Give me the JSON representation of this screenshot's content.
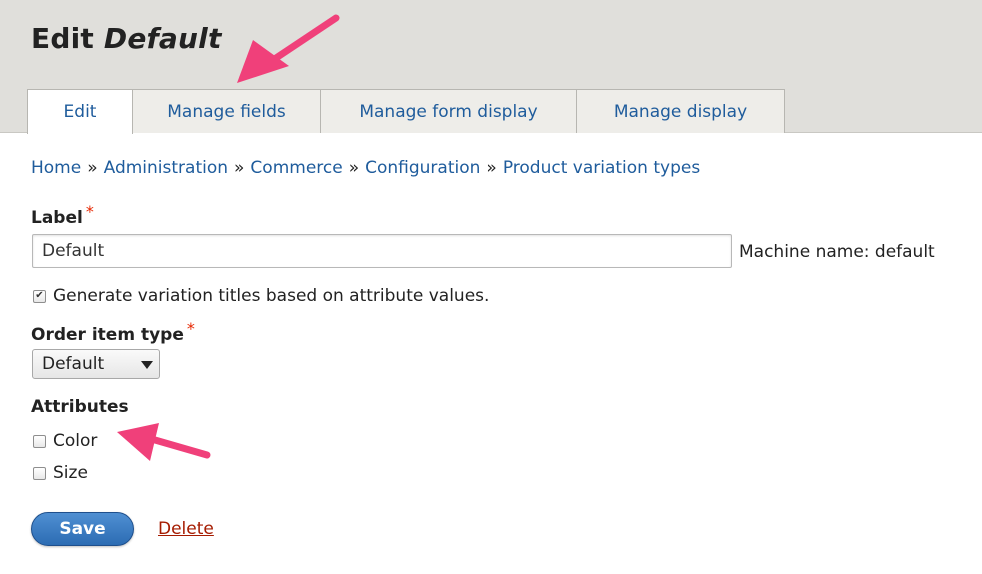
{
  "page": {
    "title_prefix": "Edit",
    "title_name": "Default"
  },
  "tabs": [
    {
      "label": "Edit",
      "active": true
    },
    {
      "label": "Manage fields"
    },
    {
      "label": "Manage form display"
    },
    {
      "label": "Manage display"
    }
  ],
  "breadcrumb": {
    "items": [
      "Home",
      "Administration",
      "Commerce",
      "Configuration",
      "Product variation types"
    ],
    "separator": "»"
  },
  "form": {
    "label_field": {
      "label": "Label",
      "required_mark": "*",
      "value": "Default",
      "machine_name": "Machine name: default"
    },
    "generate_titles": {
      "label": "Generate variation titles based on attribute values.",
      "checked": true,
      "check_glyph": "✔"
    },
    "order_item_type": {
      "label": "Order item type",
      "required_mark": "*",
      "selected": "Default"
    },
    "attributes": {
      "heading": "Attributes",
      "options": [
        {
          "label": "Color",
          "checked": false
        },
        {
          "label": "Size",
          "checked": false
        }
      ]
    },
    "save_label": "Save",
    "delete_label": "Delete"
  },
  "colors": {
    "link": "#1f5c9c",
    "required": "#e62600",
    "annotation_arrow": "#f0407a",
    "save": "#2c6cb3",
    "delete": "#a51b00"
  }
}
